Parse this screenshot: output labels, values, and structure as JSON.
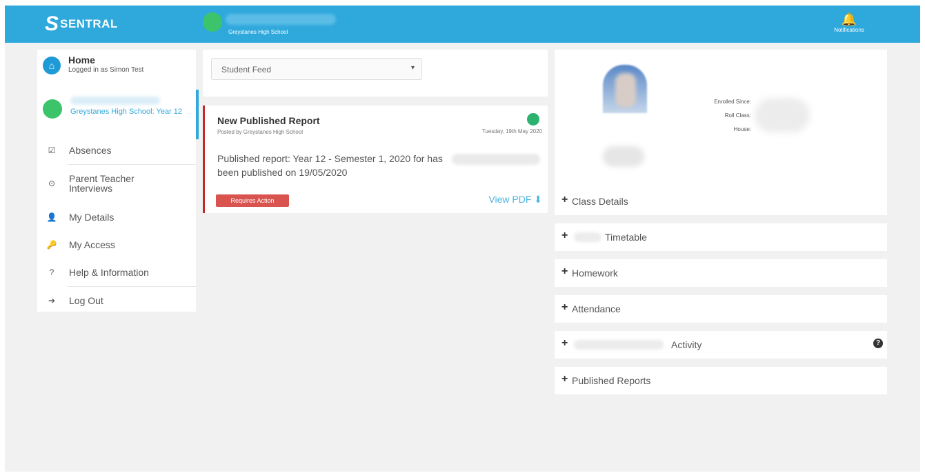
{
  "header": {
    "logo_glyph": "S",
    "logo_text": "SENTRAL",
    "school_name": "Greystanes High School",
    "notifications_label": "Notifications",
    "bell_glyph": "🔔",
    "accent_color": "#2fa8dc"
  },
  "sidebar": {
    "home": {
      "title": "Home",
      "subtitle": "Logged in as Simon Test",
      "icon": "home-icon"
    },
    "student": {
      "school_year": "Greystanes High School: Year 12"
    },
    "items": [
      {
        "label": "Absences",
        "icon": "checkbox-icon",
        "glyph": "☑"
      },
      {
        "label": "Parent Teacher Interviews",
        "icon": "clock-icon",
        "glyph": "⊙"
      },
      {
        "label": "My Details",
        "icon": "user-icon",
        "glyph": "👤"
      },
      {
        "label": "My Access",
        "icon": "key-icon",
        "glyph": "🔑"
      },
      {
        "label": "Help & Information",
        "icon": "question-icon",
        "glyph": "?"
      },
      {
        "label": "Log Out",
        "icon": "logout-icon",
        "glyph": "➔"
      }
    ]
  },
  "feed": {
    "filter_value": "Student Feed",
    "chevron": "▾",
    "card": {
      "title": "New Published Report",
      "posted_by": "Posted by Greystanes High School",
      "date": "Tuesday, 19th May 2020",
      "body": "Published report: Year 12 - Semester 1, 2020 for has been published on 19/05/2020",
      "action_badge": "Requires Action",
      "view_pdf": "View PDF ⬇",
      "status_color": "#c62828"
    }
  },
  "profile": {
    "meta_labels": [
      "Enrolled Since:",
      "Roll Class:",
      "House:"
    ]
  },
  "sections": [
    {
      "plus": "+",
      "label": "Class Details"
    },
    {
      "plus": "+",
      "label": "Timetable"
    },
    {
      "plus": "+",
      "label": "Homework"
    },
    {
      "plus": "+",
      "label": "Attendance"
    },
    {
      "plus": "+",
      "label": "Activity",
      "help": "?"
    },
    {
      "plus": "+",
      "label": "Published Reports"
    }
  ]
}
